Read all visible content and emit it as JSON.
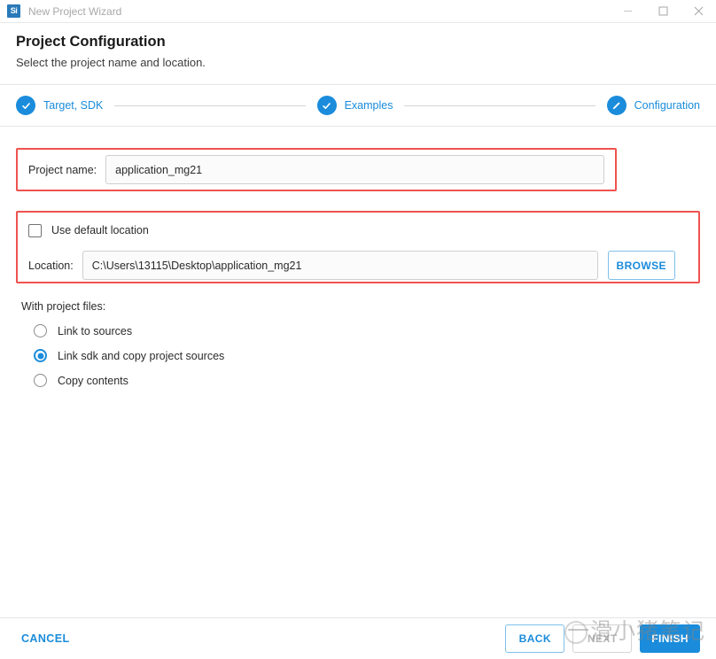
{
  "window": {
    "icon_label": "Si",
    "title": "New Project Wizard",
    "controls": {
      "minimize": "minimize-icon",
      "maximize": "maximize-icon",
      "close": "close-icon"
    }
  },
  "header": {
    "title": "Project Configuration",
    "subtitle": "Select the project name and location."
  },
  "stepper": {
    "steps": [
      {
        "label": "Target, SDK",
        "icon": "check-icon",
        "state": "completed"
      },
      {
        "label": "Examples",
        "icon": "check-icon",
        "state": "completed"
      },
      {
        "label": "Configuration",
        "icon": "pencil-icon",
        "state": "current"
      }
    ]
  },
  "form": {
    "project_name": {
      "label": "Project name:",
      "value": "application_mg21",
      "placeholder": "Project name"
    },
    "use_default_location": {
      "label": "Use default location",
      "checked": false
    },
    "location": {
      "label": "Location:",
      "value": "C:\\Users\\13115\\Desktop\\application_mg21",
      "placeholder": "Location",
      "browse_label": "BROWSE"
    },
    "with_project_files": {
      "label": "With project files:",
      "options": [
        {
          "label": "Link to sources",
          "selected": false
        },
        {
          "label": "Link sdk and copy project sources",
          "selected": true
        },
        {
          "label": "Copy contents",
          "selected": false
        }
      ]
    }
  },
  "footer": {
    "cancel_label": "CANCEL",
    "back_label": "BACK",
    "next_label": "NEXT",
    "finish_label": "FINISH"
  },
  "watermark": {
    "text": "一滑小猪笔记"
  },
  "colors": {
    "accent": "#1a8cdb",
    "highlight": "#ef5350",
    "disabled": "#b5b5b5"
  }
}
